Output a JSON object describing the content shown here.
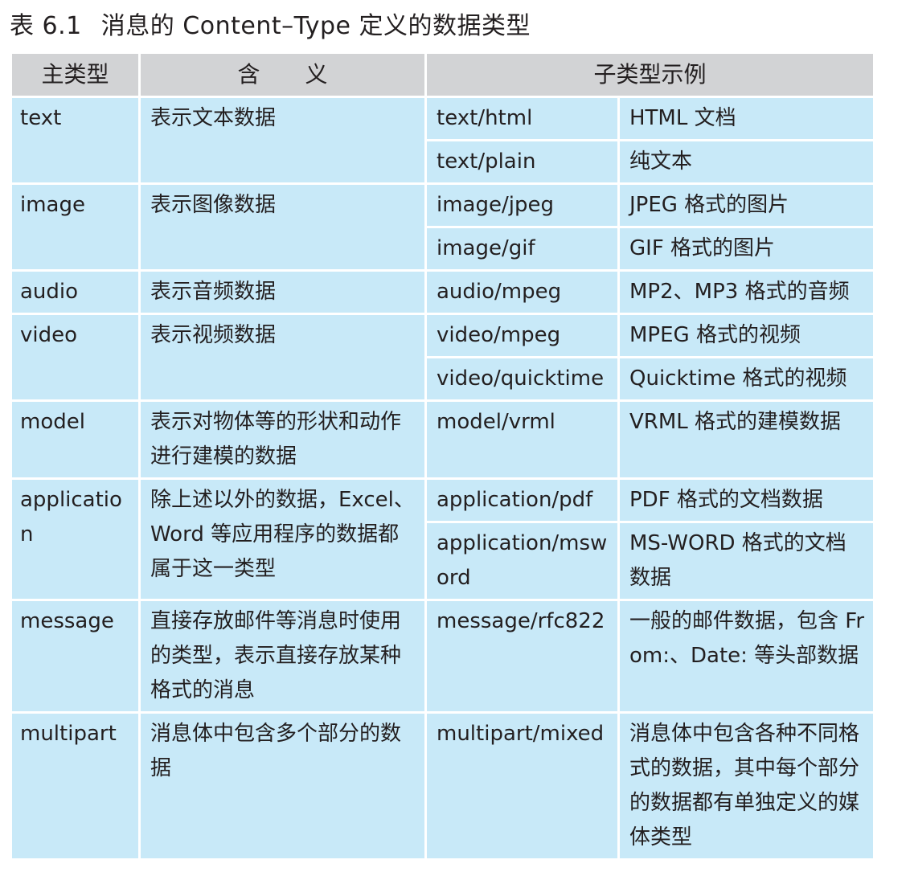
{
  "caption": {
    "number": "表 6.1",
    "title": "消息的 Content–Type 定义的数据类型"
  },
  "headers": {
    "main_type": "主类型",
    "meaning": "含　　义",
    "subtype_examples": "子类型示例"
  },
  "rows": [
    {
      "type": "text",
      "meaning": "表示文本数据",
      "subtypes": [
        {
          "name": "text/html",
          "desc": "HTML 文档"
        },
        {
          "name": "text/plain",
          "desc": "纯文本"
        }
      ]
    },
    {
      "type": "image",
      "meaning": "表示图像数据",
      "subtypes": [
        {
          "name": "image/jpeg",
          "desc": "JPEG 格式的图片"
        },
        {
          "name": "image/gif",
          "desc": "GIF 格式的图片"
        }
      ]
    },
    {
      "type": "audio",
      "meaning": "表示音频数据",
      "subtypes": [
        {
          "name": "audio/mpeg",
          "desc": "MP2、MP3 格式的音频"
        }
      ]
    },
    {
      "type": "video",
      "meaning": "表示视频数据",
      "subtypes": [
        {
          "name": "video/mpeg",
          "desc": "MPEG 格式的视频"
        },
        {
          "name": "video/quicktime",
          "desc": "Quicktime 格式的视频"
        }
      ]
    },
    {
      "type": "model",
      "meaning": "表示对物体等的形状和动作进行建模的数据",
      "subtypes": [
        {
          "name": "model/vrml",
          "desc": "VRML 格式的建模数据"
        }
      ]
    },
    {
      "type": "application",
      "meaning": "除上述以外的数据，Excel、Word 等应用程序的数据都属于这一类型",
      "subtypes": [
        {
          "name": "application/pdf",
          "desc": "PDF 格式的文档数据"
        },
        {
          "name": "application/msword",
          "desc": "MS-WORD 格式的文档数据"
        }
      ]
    },
    {
      "type": "message",
      "meaning": "直接存放邮件等消息时使用的类型，表示直接存放某种格式的消息",
      "subtypes": [
        {
          "name": "message/rfc822",
          "desc": "一般的邮件数据，包含 From:、Date: 等头部数据"
        }
      ]
    },
    {
      "type": "multipart",
      "meaning": "消息体中包含多个部分的数据",
      "subtypes": [
        {
          "name": "multipart/mixed",
          "desc": "消息体中包含各种不同格式的数据，其中每个部分的数据都有单独定义的媒体类型"
        }
      ]
    }
  ]
}
